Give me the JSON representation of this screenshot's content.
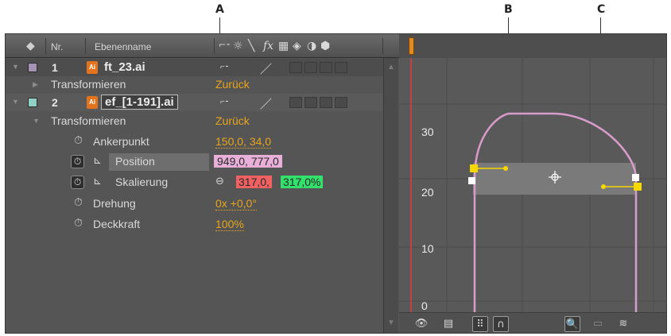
{
  "callouts": {
    "a": "A",
    "b": "B",
    "c": "C"
  },
  "header": {
    "tag_icon": "label-tag-icon",
    "number_col": "Nr.",
    "name_col": "Ebenenname",
    "switch_icons": [
      "shy-icon",
      "sun-icon",
      "slash-icon",
      "fx",
      "film-icon",
      "sphere-icon",
      "circle-half-icon",
      "cube-icon"
    ]
  },
  "layers": [
    {
      "number": "1",
      "name": "ft_23.ai",
      "label_color": "#a593b4",
      "icon": "illustrator-file-icon"
    },
    {
      "number": "2",
      "name": "ef_[1-191].ai",
      "label_color": "#8fd1c5",
      "icon": "illustrator-file-icon"
    }
  ],
  "groups": [
    {
      "label": "Transformieren",
      "reset": "Zurück"
    },
    {
      "label": "Transformieren",
      "reset": "Zurück"
    }
  ],
  "properties": [
    {
      "name": "Ankerpunkt",
      "value": "150,0, 34,0",
      "keyframed": false
    },
    {
      "name": "Position",
      "value": "949,0, 777,0",
      "keyframed": true,
      "selected": true
    },
    {
      "name": "Skalierung",
      "value_x": "317,0,",
      "value_y": "317,0%",
      "keyframed": true,
      "link_icon": "chain-link-icon"
    },
    {
      "name": "Drehung",
      "value": "0x +0,0°",
      "keyframed": false
    },
    {
      "name": "Deckkraft",
      "value": "100%",
      "keyframed": false
    }
  ],
  "colors": {
    "position_highlight": "#e8b0d8",
    "scale_x_highlight": "#f06161",
    "scale_y_highlight": "#34e06c",
    "value_orange": "#e8a51c",
    "curve_pink": "#d89ccb",
    "time_marker_red": "#e23b3b",
    "keyframe_yellow": "#f5d800"
  },
  "graph": {
    "y_ticks": [
      "30",
      "20",
      "10",
      "0"
    ]
  },
  "graph_toolbar": [
    "eye-icon",
    "graph-type-icon",
    "transform-box-icon",
    "snap-magnet-icon",
    "fit-selection-zoom-icon",
    "fit-all-icon",
    "auto-zoom-icon"
  ]
}
